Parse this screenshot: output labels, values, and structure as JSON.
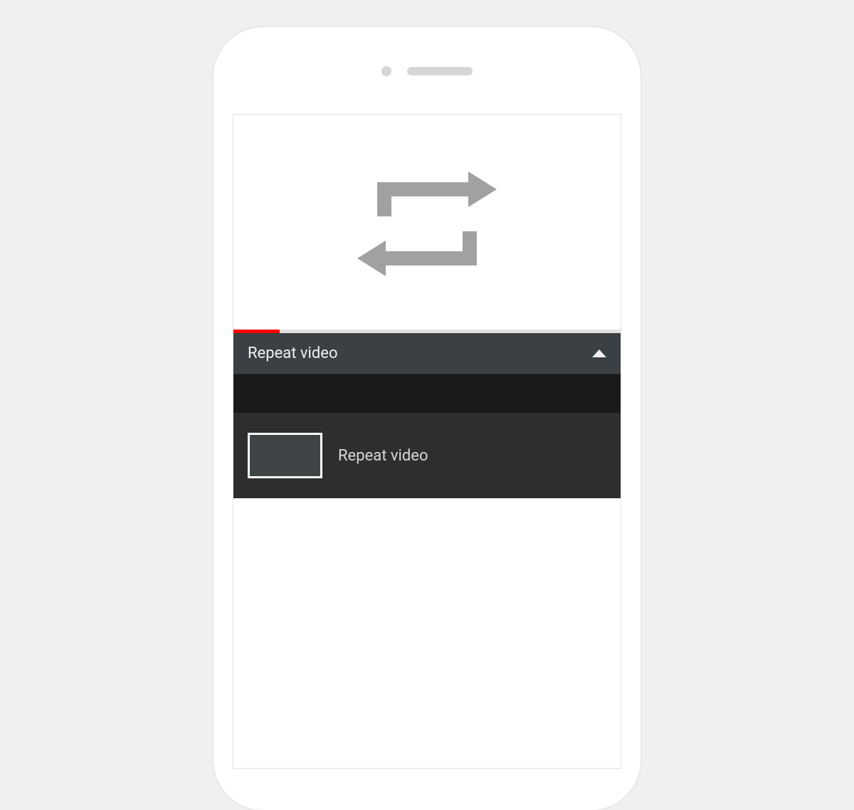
{
  "playlist": {
    "header_label": "Repeat video",
    "items": [
      {
        "label": "Repeat video"
      }
    ]
  },
  "progress": {
    "percent": 12
  }
}
